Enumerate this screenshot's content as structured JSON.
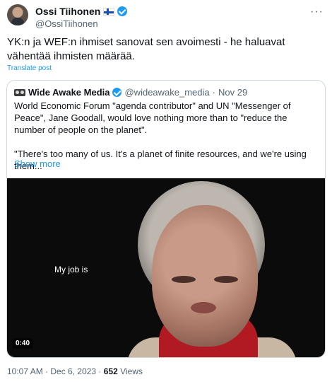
{
  "tweet": {
    "author": {
      "display_name": "Ossi Tiihonen",
      "handle": "@OssiTiihonen",
      "flag": "finnish-flag",
      "verified": true
    },
    "text": "YK:n ja WEF:n ihmiset sanovat sen avoimesti - he haluavat vähentää ihmisten määrää.",
    "translate_label": "Translate post",
    "more_label": "···",
    "meta": {
      "time": "10:07 AM",
      "sep1": " · ",
      "date": "Dec 6, 2023",
      "sep2": " · ",
      "views_count": "652",
      "views_label": " Views"
    }
  },
  "quote": {
    "author": {
      "display_name": "Wide Awake Media",
      "handle": "@wideawake_media",
      "separator": "·",
      "date": "Nov 29",
      "verified": true
    },
    "text_p1": "World Economic Forum \"agenda contributor\" and UN \"Messenger of Peace\", Jane Goodall, would love nothing more than to \"reduce the number of people on the planet\".",
    "text_p2": "\"There's too many of us. It's a planet of finite resources, and we're using them...",
    "show_more": "Show more",
    "video": {
      "caption": "My job is",
      "duration": "0:40"
    }
  },
  "colors": {
    "accent": "#1d9bf0",
    "text_primary": "#0f1419",
    "text_secondary": "#536471",
    "border": "#cfd9de"
  }
}
